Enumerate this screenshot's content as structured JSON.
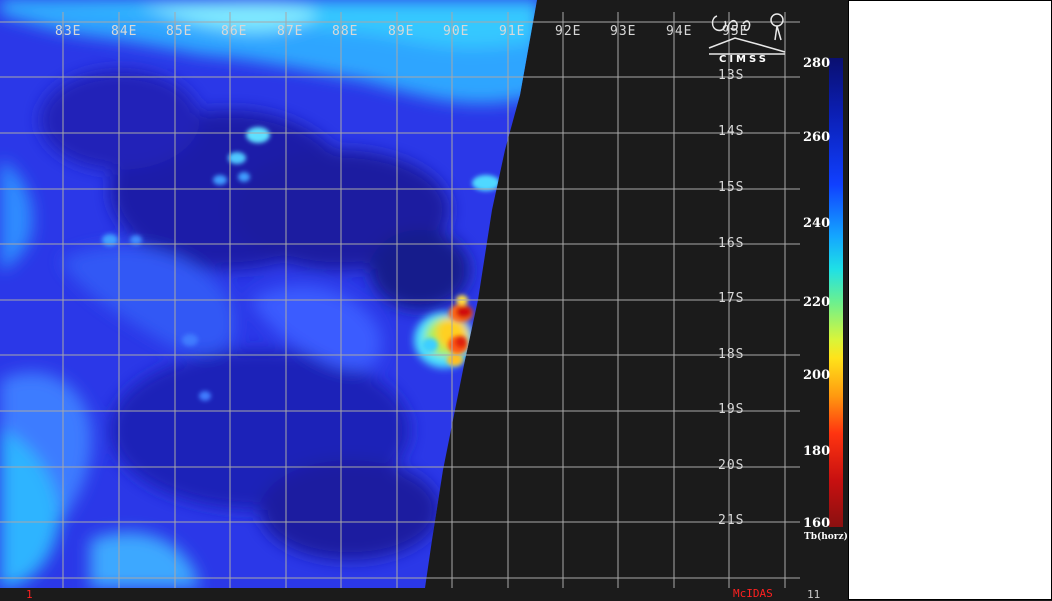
{
  "longitude_labels": [
    "83E",
    "84E",
    "85E",
    "86E",
    "87E",
    "88E",
    "89E",
    "90E",
    "91E",
    "92E",
    "93E",
    "94E",
    "95E"
  ],
  "latitude_labels": [
    "13S",
    "14S",
    "15S",
    "16S",
    "17S",
    "18S",
    "19S",
    "20S",
    "21S"
  ],
  "colorbar": {
    "ticks": [
      "280",
      "260",
      "240",
      "220",
      "200",
      "180",
      "160"
    ],
    "unit_label": "Tb(horz)",
    "colors_top_to_bottom": [
      "#0a0f70",
      "#0b1fb5",
      "#1040ff",
      "#14a6ff",
      "#1fe0e6",
      "#6bf08f",
      "#d9f53a",
      "#ffe31a",
      "#ff9a10",
      "#ff3410",
      "#c81010",
      "#8a1010"
    ]
  },
  "logo": {
    "text": "CIMSS",
    "icon": "cimss-logo-icon"
  },
  "footer": {
    "left_code": "1",
    "software": "McIDAS",
    "right_code": "11"
  },
  "imagery": {
    "background_color": "#2020e0",
    "no_data_color": "#1b1b1b",
    "grid_color": "#a8a8a8",
    "cold_core": [
      "#ffe31a",
      "#ff3410",
      "#c81010"
    ]
  }
}
